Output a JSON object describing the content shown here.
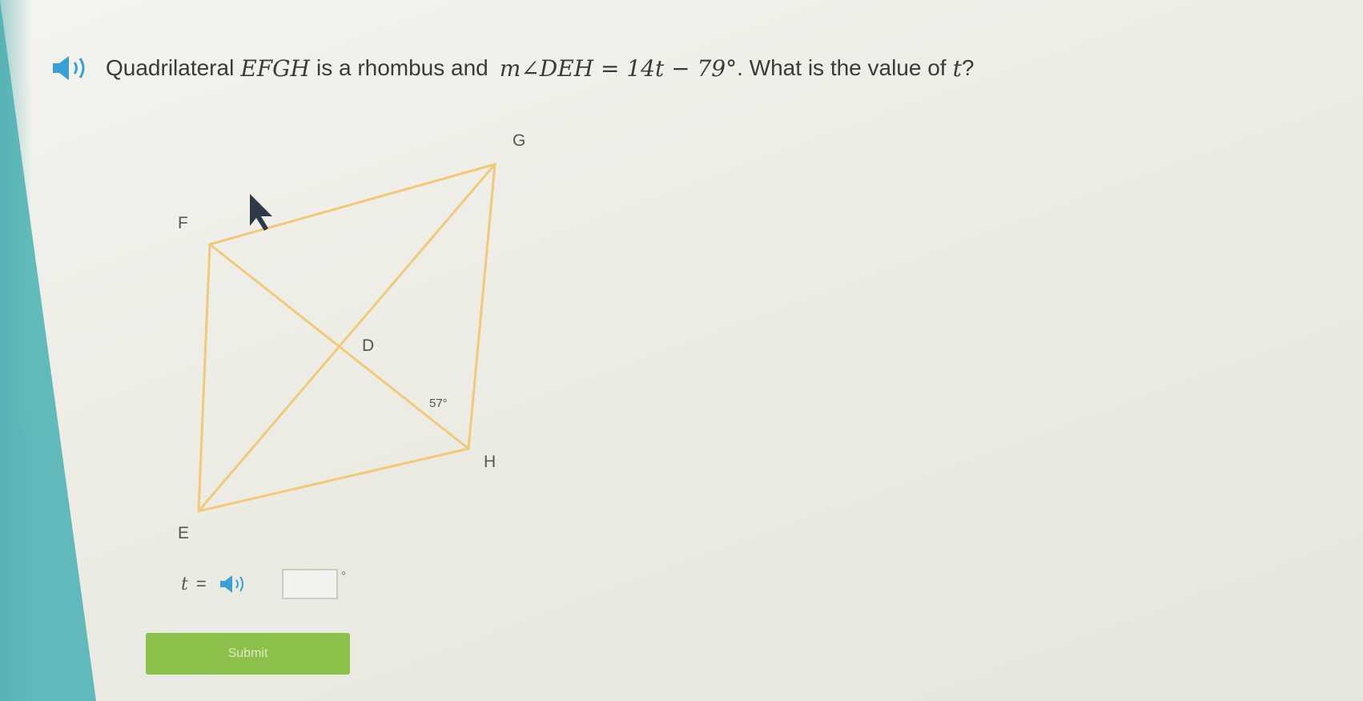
{
  "question": {
    "lead": "Quadrilateral",
    "shape_name": "EFGH",
    "middle": "is a rhombus and",
    "expression": "m∠DEH = 14t − 79°",
    "tail": ". What is the value of",
    "variable": "t",
    "end": "?"
  },
  "figure": {
    "vertices": {
      "E": "E",
      "F": "F",
      "G": "G",
      "H": "H",
      "D": "D"
    },
    "angle_label": "57°",
    "line_color": "#f2c97a"
  },
  "answer": {
    "variable": "t",
    "equals": "=",
    "value": "",
    "unit": "°"
  },
  "submit_label": "Submit",
  "colors": {
    "accent": "#8cc04a",
    "speaker": "#3a9fd6",
    "side_strip": "#5ab6b8"
  },
  "icons": {
    "question_audio": "speaker-icon",
    "answer_audio": "speaker-icon",
    "cursor": "mouse-cursor-icon"
  }
}
